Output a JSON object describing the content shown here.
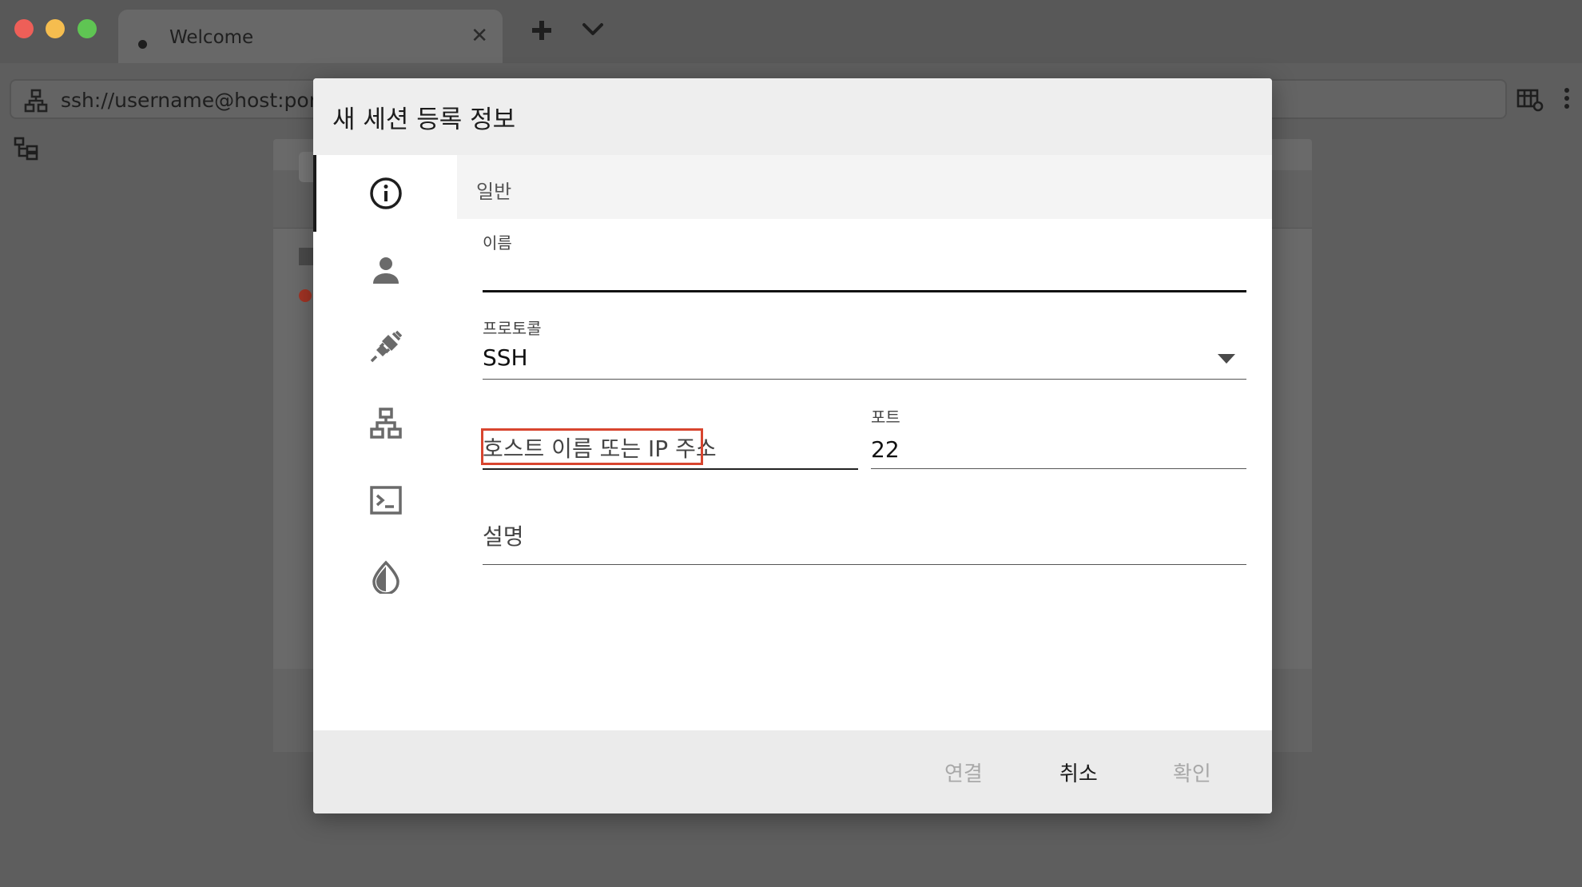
{
  "tabs": [
    {
      "title": "Welcome",
      "close_glyph": "✕"
    }
  ],
  "address_bar": {
    "placeholder": "ssh://username@host:port"
  },
  "dialog": {
    "title": "새 세션 등록 정보",
    "nav": [
      {
        "icon": "info-icon",
        "active": true
      },
      {
        "icon": "person-icon",
        "active": false
      },
      {
        "icon": "connection-plug-icon",
        "active": false
      },
      {
        "icon": "network-icon",
        "active": false
      },
      {
        "icon": "terminal-icon",
        "active": false
      },
      {
        "icon": "theme-drop-icon",
        "active": false
      }
    ],
    "section_title": "일반",
    "fields": {
      "name_label": "이름",
      "name_value": "",
      "protocol_label": "프로토콜",
      "protocol_value": "SSH",
      "host_placeholder": "호스트 이름 또는 IP 주소",
      "port_label": "포트",
      "port_value": "22",
      "description_placeholder": "설명"
    },
    "buttons": {
      "connect": "연결",
      "cancel": "취소",
      "ok": "확인"
    }
  },
  "colors": {
    "highlight": "#d8452f",
    "overlay": "#5e5e5e"
  }
}
